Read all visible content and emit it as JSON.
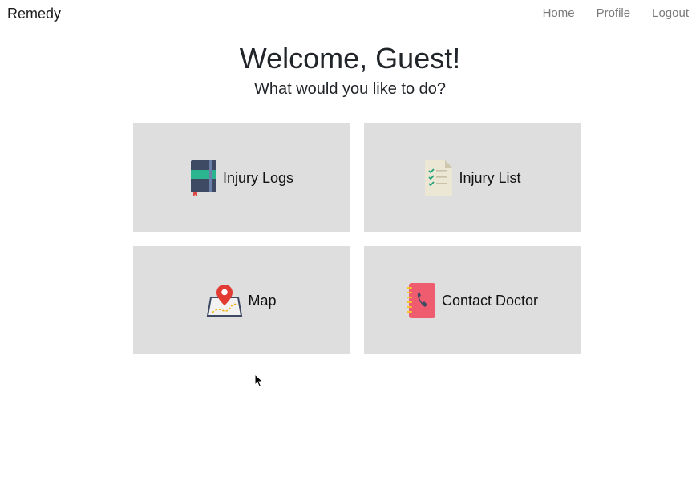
{
  "nav": {
    "brand": "Remedy",
    "links": [
      "Home",
      "Profile",
      "Logout"
    ]
  },
  "header": {
    "title": "Welcome, Guest!",
    "subtitle": "What would you like to do?"
  },
  "tiles": [
    {
      "label": "Injury Logs",
      "icon": "notebook-icon"
    },
    {
      "label": "Injury List",
      "icon": "checklist-document-icon"
    },
    {
      "label": "Map",
      "icon": "map-pin-icon"
    },
    {
      "label": "Contact Doctor",
      "icon": "phone-book-icon"
    }
  ],
  "colors": {
    "tile_bg": "#dedede",
    "nav_link": "#7a7a7a",
    "text": "#212529"
  }
}
